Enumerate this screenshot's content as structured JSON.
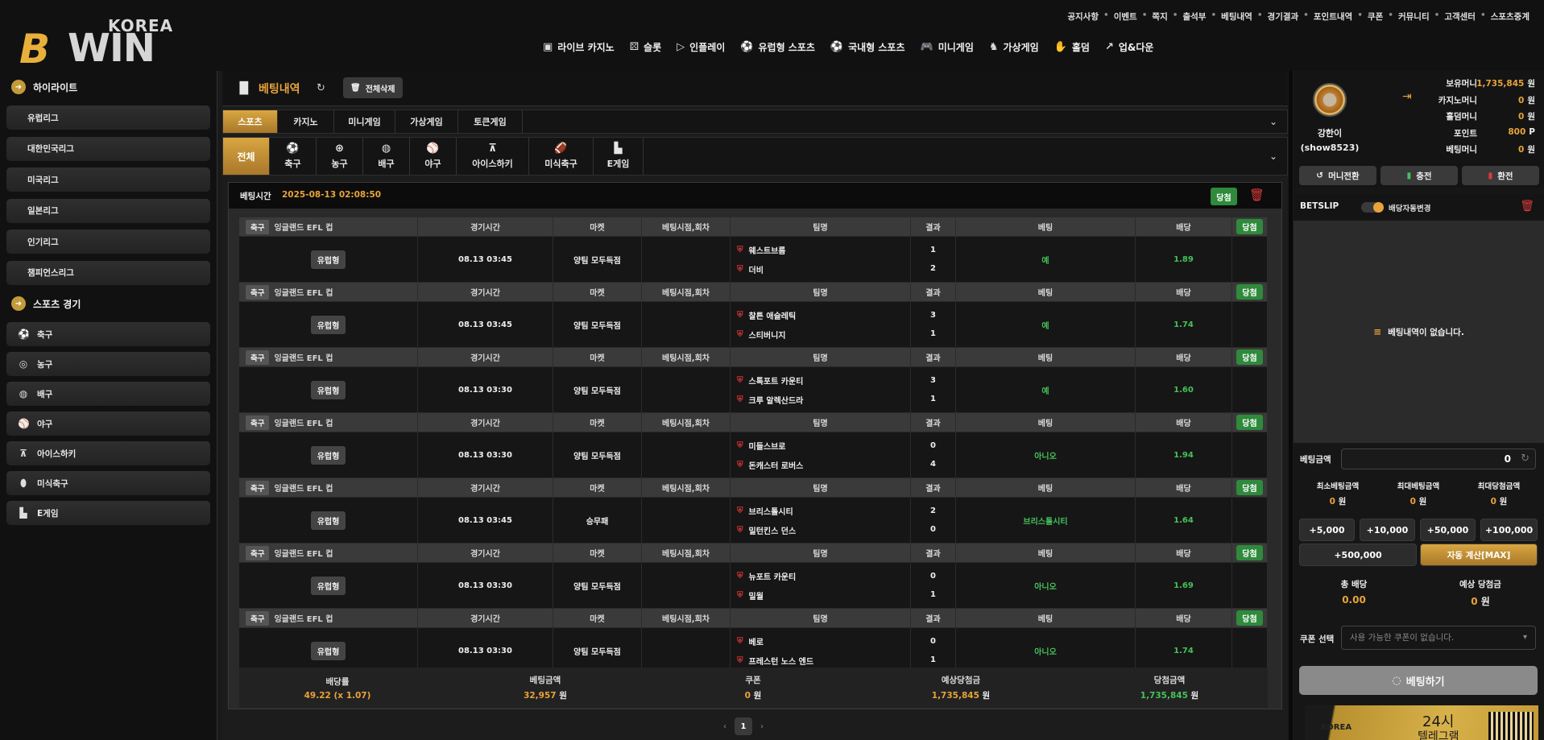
{
  "brand": {
    "korea": "KOREA",
    "win": "WIN",
    "b": "B"
  },
  "toplinks": [
    "공지사항",
    "이벤트",
    "쪽지",
    "출석부",
    "베팅내역",
    "경기결과",
    "포인트내역",
    "쿠폰",
    "커뮤니티",
    "고객센터",
    "스포츠중계"
  ],
  "mainnav": [
    {
      "icon": "card-icon",
      "label": "라이브 카지노"
    },
    {
      "icon": "dice-icon",
      "label": "슬롯"
    },
    {
      "icon": "play-icon",
      "label": "인플레이"
    },
    {
      "icon": "soccer-icon",
      "label": "유럽형 스포츠"
    },
    {
      "icon": "soccer-icon",
      "label": "국내형 스포츠"
    },
    {
      "icon": "gamepad-icon",
      "label": "미니게임"
    },
    {
      "icon": "horse-icon",
      "label": "가상게임"
    },
    {
      "icon": "glove-icon",
      "label": "홀덤"
    },
    {
      "icon": "trend-icon",
      "label": "업&다운"
    }
  ],
  "sidebar": {
    "highlight_title": "하이라이트",
    "leagues": [
      "유럽리그",
      "대한민국리그",
      "미국리그",
      "일본리그",
      "인기리그",
      "챔피언스리그"
    ],
    "sports_title": "스포츠 경기",
    "sports": [
      {
        "icon": "soccer-icon",
        "label": "축구"
      },
      {
        "icon": "basketball-icon",
        "label": "농구"
      },
      {
        "icon": "volleyball-icon",
        "label": "배구"
      },
      {
        "icon": "baseball-icon",
        "label": "야구"
      },
      {
        "icon": "hockey-icon",
        "label": "아이스하키"
      },
      {
        "icon": "football-icon",
        "label": "미식축구"
      },
      {
        "icon": "esports-icon",
        "label": "E게임"
      }
    ]
  },
  "page": {
    "title": "베팅내역",
    "delete_all": "전체삭제"
  },
  "tabs": [
    "스포츠",
    "카지노",
    "미니게임",
    "가상게임",
    "토큰게임"
  ],
  "sport_tabs": [
    {
      "label": "전체",
      "icon": ""
    },
    {
      "label": "축구",
      "icon": "⚽"
    },
    {
      "label": "농구",
      "icon": "⊛"
    },
    {
      "label": "배구",
      "icon": "◍"
    },
    {
      "label": "야구",
      "icon": "⚾"
    },
    {
      "label": "아이스하키",
      "icon": "⊼"
    },
    {
      "label": "미식축구",
      "icon": "🏈"
    },
    {
      "label": "E게임",
      "icon": "▙"
    }
  ],
  "bet": {
    "time_label": "베팅시간",
    "time": "2025-08-13 02:08:50",
    "status": "당첨",
    "headers": {
      "time": "경기시간",
      "market": "마켓",
      "point": "베팅시점,회차",
      "team": "팀명",
      "result": "결과",
      "bet": "베팅",
      "odds": "배당"
    },
    "rows": [
      {
        "sport": "축구",
        "league": "잉글랜드 EFL 컵",
        "type": "유럽형",
        "time": "08.13 03:45",
        "market": "양팀 모두득점",
        "team1": "웨스트브롬",
        "team2": "더비",
        "score1": "1",
        "score2": "2",
        "pick": "예",
        "odds": "1.89",
        "status": "당첨"
      },
      {
        "sport": "축구",
        "league": "잉글랜드 EFL 컵",
        "type": "유럽형",
        "time": "08.13 03:45",
        "market": "양팀 모두득점",
        "team1": "찰튼 애슬레틱",
        "team2": "스티버니지",
        "score1": "3",
        "score2": "1",
        "pick": "예",
        "odds": "1.74",
        "status": "당첨"
      },
      {
        "sport": "축구",
        "league": "잉글랜드 EFL 컵",
        "type": "유럽형",
        "time": "08.13 03:30",
        "market": "양팀 모두득점",
        "team1": "스톡포트 카운티",
        "team2": "크루 알렉산드라",
        "score1": "3",
        "score2": "1",
        "pick": "예",
        "odds": "1.60",
        "status": "당첨"
      },
      {
        "sport": "축구",
        "league": "잉글랜드 EFL 컵",
        "type": "유럽형",
        "time": "08.13 03:30",
        "market": "양팀 모두득점",
        "team1": "미들스브로",
        "team2": "돈캐스터 로버스",
        "score1": "0",
        "score2": "4",
        "pick": "아니오",
        "odds": "1.94",
        "status": "당첨"
      },
      {
        "sport": "축구",
        "league": "잉글랜드 EFL 컵",
        "type": "유럽형",
        "time": "08.13 03:45",
        "market": "승무패",
        "team1": "브리스톨시티",
        "team2": "밀턴킨스 던스",
        "score1": "2",
        "score2": "0",
        "pick": "브리스톨시티",
        "odds": "1.64",
        "status": "당첨"
      },
      {
        "sport": "축구",
        "league": "잉글랜드 EFL 컵",
        "type": "유럽형",
        "time": "08.13 03:30",
        "market": "양팀 모두득점",
        "team1": "뉴포트 카운티",
        "team2": "밀월",
        "score1": "0",
        "score2": "1",
        "pick": "아니오",
        "odds": "1.69",
        "status": "당첨"
      },
      {
        "sport": "축구",
        "league": "잉글랜드 EFL 컵",
        "type": "유럽형",
        "time": "08.13 03:30",
        "market": "양팀 모두득점",
        "team1": "베로",
        "team2": "프레스턴 노스 엔드",
        "score1": "0",
        "score2": "1",
        "pick": "아니오",
        "odds": "1.74",
        "status": "당첨"
      }
    ],
    "summary": {
      "odds_label": "배당률",
      "odds_value": "49.22 (x 1.07)",
      "amount_label": "베팅금액",
      "amount_value": "32,957",
      "amount_unit": "원",
      "coupon_label": "쿠폰",
      "coupon_value": "0",
      "coupon_unit": "원",
      "expected_label": "예상당첨금",
      "expected_value": "1,735,845",
      "expected_unit": "원",
      "win_label": "당첨금액",
      "win_value": "1,735,845",
      "win_unit": "원"
    }
  },
  "pager": {
    "prev": "‹",
    "page": "1",
    "next": "›"
  },
  "user": {
    "name": "강한이",
    "id": "(show8523)",
    "balances": [
      {
        "label": "보유머니",
        "value": "1,735,845",
        "unit": "원",
        "color": "#e8a33a"
      },
      {
        "label": "카지노머니",
        "value": "0",
        "unit": "원",
        "color": "#e8a33a"
      },
      {
        "label": "홀덤머니",
        "value": "0",
        "unit": "원",
        "color": "#e8a33a"
      },
      {
        "label": "포인트",
        "value": "800",
        "unit": "P",
        "color": "#e8a33a"
      },
      {
        "label": "베팅머니",
        "value": "0",
        "unit": "원",
        "color": "#e8a33a"
      }
    ],
    "btn_convert": "머니전환",
    "btn_charge": "충전",
    "btn_exchange": "환전"
  },
  "betslip": {
    "title": "BETSLIP",
    "toggle_label": "배당자동변경",
    "empty": "베팅내역이 없습니다.",
    "amount_label": "베팅금액",
    "amount": "0",
    "min_label": "최소베팅금액",
    "min": "0",
    "max_label": "최대베팅금액",
    "max": "0",
    "maxwin_label": "최대당첨금액",
    "maxwin": "0",
    "unit": "원",
    "quick": [
      "+5,000",
      "+10,000",
      "+50,000",
      "+100,000",
      "+500,000"
    ],
    "auto": "자동 계산[MAX]",
    "total_odds_label": "총 배당",
    "total_odds": "0.00",
    "expected_label": "예상 당첨금",
    "expected": "0",
    "coupon_label": "쿠폰 선택",
    "coupon_placeholder": "사용 가능한 쿠폰이 없습니다.",
    "bet_button": "베팅하기"
  },
  "banner": {
    "korea": "KOREA",
    "h": "24시",
    "sub": "텔레그램"
  }
}
